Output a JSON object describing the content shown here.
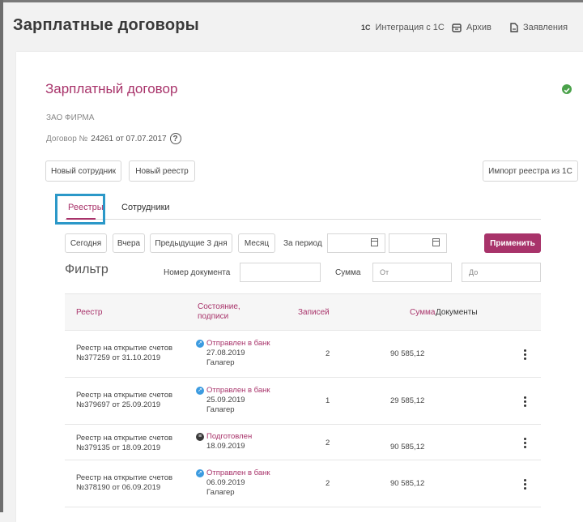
{
  "header": {
    "title": "Зарплатные договоры",
    "nav": [
      {
        "icon": "1c-icon",
        "label": "Интеграция с 1С"
      },
      {
        "icon": "archive-icon",
        "label": "Архив"
      },
      {
        "icon": "document-icon",
        "label": "Заявления"
      }
    ],
    "nav_badge": "1С"
  },
  "contract": {
    "title": "Зарплатный договор",
    "status_icon": "check-circle-icon",
    "status_color": "#4ba24b",
    "company": "ЗАО ФИРМА",
    "number_prefix": "Договор №",
    "number": "24261 от 07.07.2017",
    "help": "?"
  },
  "actions": {
    "new_employee": "Новый сотрудник",
    "new_registry": "Новый реестр",
    "import": "Импорт реестра из 1С"
  },
  "tabs": [
    {
      "label": "Реестры",
      "active": true
    },
    {
      "label": "Сотрудники",
      "active": false
    }
  ],
  "period": {
    "buttons": [
      "Сегодня",
      "Вчера",
      "Предыдущие 3 дня",
      "Месяц"
    ],
    "range_label": "За период",
    "date_from": "",
    "date_to": "",
    "apply": "Применить"
  },
  "filter": {
    "title": "Фильтр",
    "doc_number_label": "Номер документа",
    "doc_number_value": "",
    "sum_label": "Сумма",
    "sum_from_placeholder": "От",
    "sum_to_placeholder": "До"
  },
  "table": {
    "columns": [
      "Реестр",
      "Состояние, подписи",
      "Записей",
      "Сумма",
      "Документы"
    ],
    "rows": [
      {
        "registry_line1": "Реестр на открытие счетов",
        "registry_line2": "№377259 от 31.10.2019",
        "status": "Отправлен в банк",
        "status_icon": "sent-icon",
        "date": "27.08.2019",
        "signer": "Галагер",
        "records": "2",
        "sum": "90 585,12"
      },
      {
        "registry_line1": "Реестр на открытие счетов",
        "registry_line2": "№379697 от 25.09.2019",
        "status": "Отправлен в банк",
        "status_icon": "sent-icon",
        "date": "25.09.2019",
        "signer": "Галагер",
        "records": "1",
        "sum": "29 585,12"
      },
      {
        "registry_line1": "Реестр на открытие счетов",
        "registry_line2": "№379135 от 18.09.2019",
        "status": "Подготовлен",
        "status_icon": "prepared-icon",
        "date": "18.09.2019",
        "signer": "",
        "records": "2",
        "sum": "90 585,12"
      },
      {
        "registry_line1": "Реестр на открытие счетов",
        "registry_line2": "№378190 от 06.09.2019",
        "status": "Отправлен в банк",
        "status_icon": "sent-icon",
        "date": "06.09.2019",
        "signer": "Галагер",
        "records": "2",
        "sum": "90 585,12"
      }
    ]
  },
  "colors": {
    "accent": "#a8336a",
    "highlight": "#2b98c8",
    "sent": "#3c9be0"
  }
}
